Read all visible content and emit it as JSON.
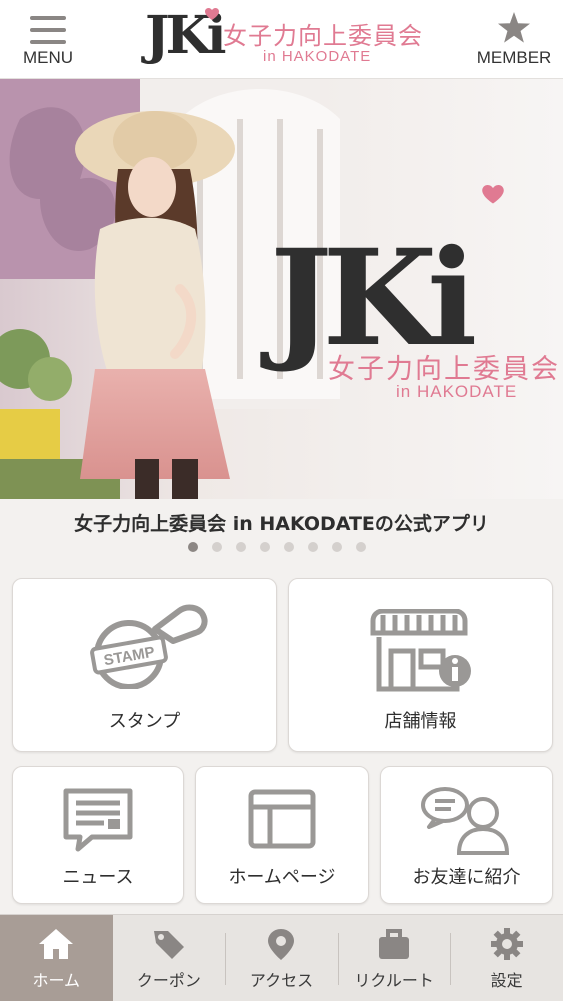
{
  "header": {
    "menu_label": "MENU",
    "member_label": "MEMBER",
    "logo": {
      "mark": "JKi",
      "title": "女子力向上委員会",
      "subtitle": "in HAKODATE"
    }
  },
  "hero": {
    "logo_mark": "JKi",
    "logo_title": "女子力向上委員会",
    "logo_subtitle": "in HAKODATE",
    "sign_text": "STAMP"
  },
  "caption": "女子力向上委員会 in HAKODATEの公式アプリ",
  "carousel": {
    "slide_count": 8,
    "active_index": 0
  },
  "tiles": {
    "stamp": {
      "label": "スタンプ",
      "icon": "stamp-icon",
      "badge": "STAMP"
    },
    "shop": {
      "label": "店舗情報",
      "icon": "shop-info-icon"
    },
    "news": {
      "label": "ニュース",
      "icon": "news-icon"
    },
    "homepage": {
      "label": "ホームページ",
      "icon": "webpage-icon"
    },
    "invite": {
      "label": "お友達に紹介",
      "icon": "invite-friend-icon"
    }
  },
  "tabbar": {
    "items": [
      {
        "label": "ホーム",
        "icon": "home-icon",
        "active": true
      },
      {
        "label": "クーポン",
        "icon": "coupon-tag-icon",
        "active": false
      },
      {
        "label": "アクセス",
        "icon": "map-pin-icon",
        "active": false
      },
      {
        "label": "リクルート",
        "icon": "briefcase-icon",
        "active": false
      },
      {
        "label": "設定",
        "icon": "gear-icon",
        "active": false
      }
    ]
  },
  "colors": {
    "accent_pink": "#e07a92",
    "tab_active": "#a89d96",
    "icon_gray": "#9a9896"
  }
}
